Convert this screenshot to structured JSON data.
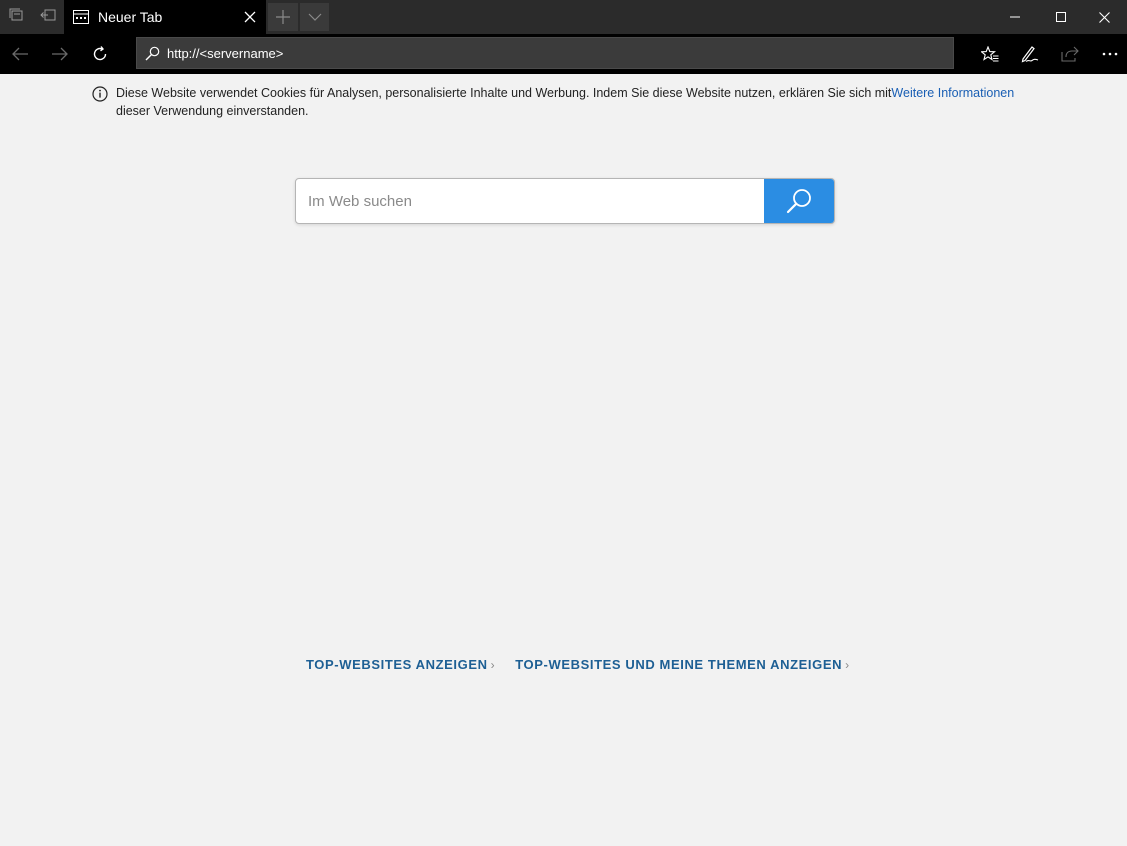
{
  "tabs": {
    "active": {
      "title": "Neuer Tab"
    }
  },
  "address": {
    "url": "http://<servername>"
  },
  "notice": {
    "text": "Diese Website verwendet Cookies für Analysen, personalisierte Inhalte und Werbung. Indem Sie diese Website nutzen, erklären Sie sich mit",
    "link": "Weitere Informationen",
    "text2": "dieser Verwendung einverstanden."
  },
  "search": {
    "placeholder": "Im Web suchen"
  },
  "links": {
    "top_sites": "TOP-WEBSITES ANZEIGEN",
    "top_sites_topics": "TOP-WEBSITES UND MEINE THEMEN ANZEIGEN"
  },
  "colors": {
    "accent": "#2b8de3",
    "link": "#1d5f94",
    "chrome_dark": "#2b2b2b"
  }
}
